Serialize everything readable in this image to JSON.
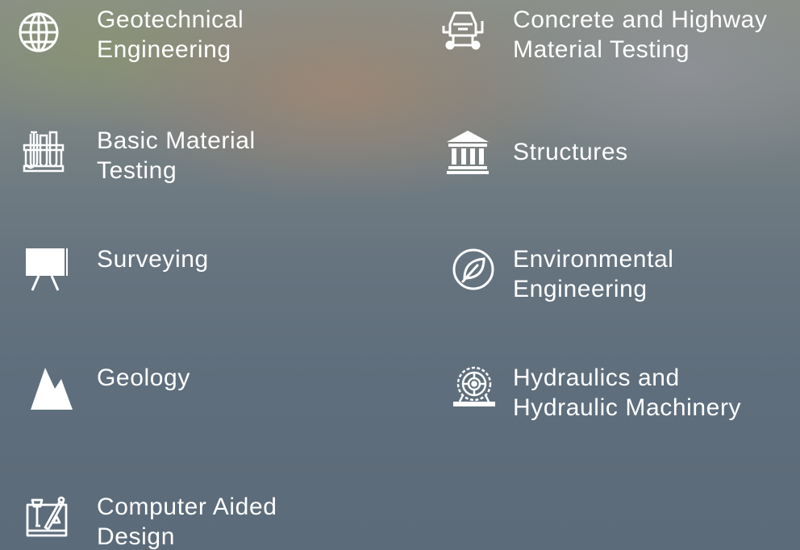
{
  "categories": [
    {
      "id": "geotechnical",
      "icon": "globe-icon",
      "lines": [
        "Geotechnical",
        "Engineering"
      ]
    },
    {
      "id": "concrete-highway",
      "icon": "concrete-mixer-icon",
      "lines": [
        "Concrete and Highway",
        "Material Testing"
      ]
    },
    {
      "id": "basic-material",
      "icon": "test-tubes-icon",
      "lines": [
        "Basic Material",
        "Testing"
      ]
    },
    {
      "id": "structures",
      "icon": "building-columns-icon",
      "lines": [
        "Structures"
      ]
    },
    {
      "id": "surveying",
      "icon": "presentation-board-icon",
      "lines": [
        "Surveying"
      ]
    },
    {
      "id": "environmental",
      "icon": "leaf-icon",
      "lines": [
        "Environmental",
        "Engineering"
      ]
    },
    {
      "id": "geology",
      "icon": "mountain-icon",
      "lines": [
        "Geology"
      ]
    },
    {
      "id": "hydraulics",
      "icon": "water-wheel-icon",
      "lines": [
        "Hydraulics and",
        "Hydraulic Machinery"
      ]
    },
    {
      "id": "cad",
      "icon": "drafting-tools-icon",
      "lines": [
        "Computer Aided",
        "Design"
      ]
    }
  ],
  "colors": {
    "text": "#ffffff",
    "icon": "#ffffff"
  }
}
